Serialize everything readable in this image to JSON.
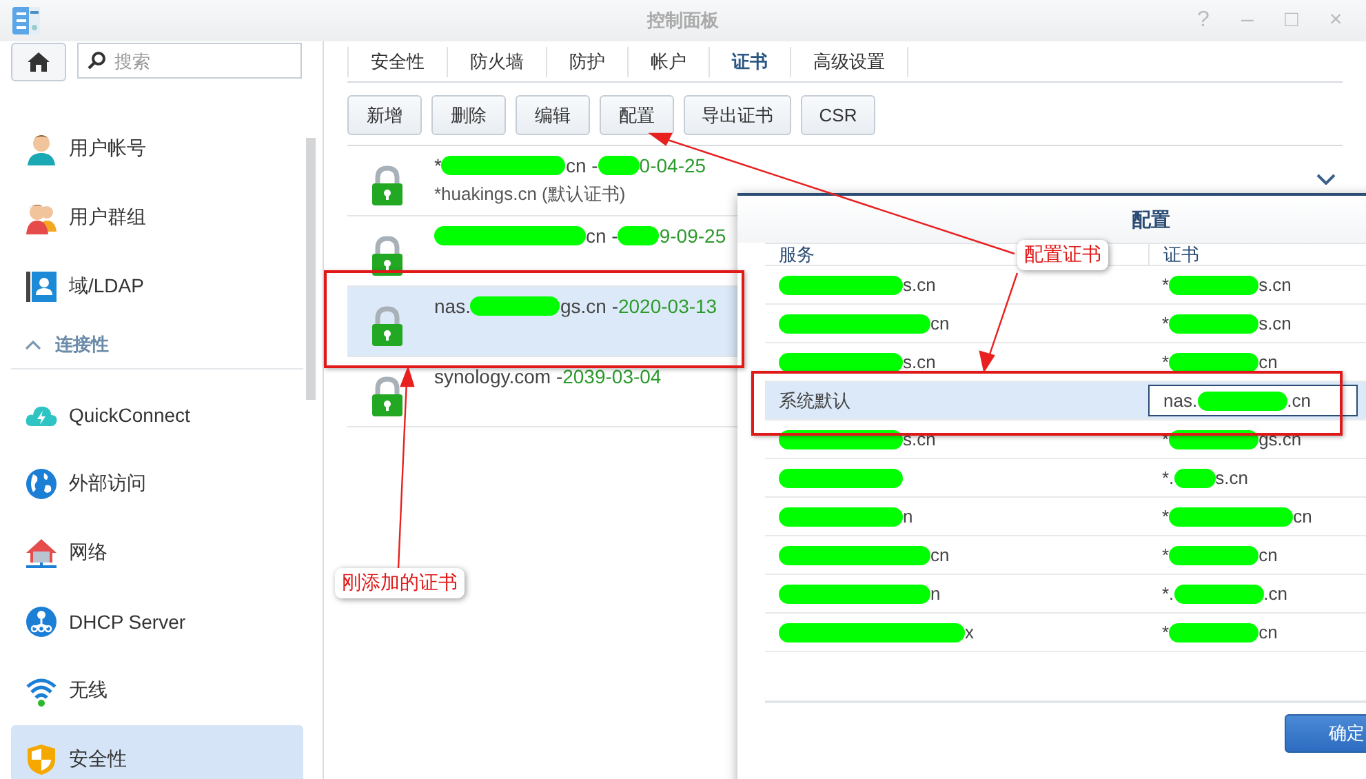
{
  "window": {
    "title": "控制面板",
    "controls": [
      "?",
      "–",
      "□",
      "×"
    ]
  },
  "search": {
    "placeholder": "搜索"
  },
  "sidebar": {
    "items": [
      {
        "kind": "item",
        "label": "用户帐号",
        "selected": false
      },
      {
        "kind": "item",
        "label": "用户群组",
        "selected": false
      },
      {
        "kind": "item",
        "label": "域/LDAP",
        "selected": false
      },
      {
        "kind": "section",
        "label": "连接性",
        "expanded": true
      },
      {
        "kind": "item",
        "label": "QuickConnect",
        "selected": false
      },
      {
        "kind": "item",
        "label": "外部访问",
        "selected": false
      },
      {
        "kind": "item",
        "label": "网络",
        "selected": false
      },
      {
        "kind": "item",
        "label": "DHCP Server",
        "selected": false
      },
      {
        "kind": "item",
        "label": "无线",
        "selected": false
      },
      {
        "kind": "item",
        "label": "安全性",
        "selected": true
      }
    ]
  },
  "tabs": [
    {
      "label": "安全性",
      "selected": false
    },
    {
      "label": "防火墙",
      "selected": false
    },
    {
      "label": "防护",
      "selected": false
    },
    {
      "label": "帐户",
      "selected": false
    },
    {
      "label": "证书",
      "selected": true
    },
    {
      "label": "高级设置",
      "selected": false
    }
  ],
  "toolbar": [
    "新增",
    "删除",
    "编辑",
    "配置",
    "导出证书",
    "CSR"
  ],
  "certificates": [
    {
      "selected": false,
      "title": [
        {
          "kind": "text",
          "t": "*"
        },
        {
          "kind": "long_mask"
        },
        {
          "kind": "text",
          "t": "cn - "
        },
        {
          "kind": "short_mask"
        },
        {
          "kind": "date",
          "t": "0-04-25"
        }
      ],
      "subtitle": "*huakings.cn (默认证书)"
    },
    {
      "selected": false,
      "title": [
        {
          "kind": "xlong_mask"
        },
        {
          "kind": "text",
          "t": "cn - "
        },
        {
          "kind": "short_mask"
        },
        {
          "kind": "date",
          "t": "9-09-25"
        }
      ]
    },
    {
      "selected": true,
      "title": [
        {
          "kind": "text",
          "t": "nas."
        },
        {
          "kind": "medium_mask"
        },
        {
          "kind": "text",
          "t": "gs.cn - "
        },
        {
          "kind": "date",
          "t": "2020-03-13"
        }
      ]
    },
    {
      "selected": false,
      "title": [
        {
          "kind": "text",
          "t": "synology.com - "
        },
        {
          "kind": "date",
          "t": "2039-03-04"
        }
      ]
    }
  ],
  "dialog": {
    "title": "配置",
    "columns": [
      "服务",
      "证书"
    ],
    "button": "确定",
    "rows": [
      {
        "selected": false,
        "service": [
          {
            "kind": "long_mask"
          },
          {
            "kind": "text",
            "t": "s.cn"
          }
        ],
        "certificate": [
          {
            "kind": "text",
            "t": "*"
          },
          {
            "kind": "medium_mask"
          },
          {
            "kind": "text",
            "t": "s.cn"
          }
        ]
      },
      {
        "selected": false,
        "service": [
          {
            "kind": "xlong_mask"
          },
          {
            "kind": "text",
            "t": "cn"
          }
        ],
        "certificate": [
          {
            "kind": "text",
            "t": "*"
          },
          {
            "kind": "medium_mask"
          },
          {
            "kind": "text",
            "t": "s.cn"
          }
        ]
      },
      {
        "selected": false,
        "service": [
          {
            "kind": "long_mask"
          },
          {
            "kind": "text",
            "t": "s.cn"
          }
        ],
        "certificate": [
          {
            "kind": "text",
            "t": "*"
          },
          {
            "kind": "medium_mask"
          },
          {
            "kind": "text",
            "t": "cn"
          }
        ]
      },
      {
        "selected": true,
        "service": [
          {
            "kind": "text",
            "t": "系统默认"
          }
        ],
        "certificate": [
          {
            "kind": "text",
            "t": "nas."
          },
          {
            "kind": "medium_mask"
          },
          {
            "kind": "text",
            "t": ".cn"
          }
        ]
      },
      {
        "selected": false,
        "service": [
          {
            "kind": "long_mask"
          },
          {
            "kind": "text",
            "t": "s.cn"
          }
        ],
        "certificate": [
          {
            "kind": "text",
            "t": "*"
          },
          {
            "kind": "medium_mask"
          },
          {
            "kind": "text",
            "t": "gs.cn"
          }
        ]
      },
      {
        "selected": false,
        "service": [
          {
            "kind": "long_mask"
          }
        ],
        "certificate": [
          {
            "kind": "text",
            "t": "*."
          },
          {
            "kind": "short_mask"
          },
          {
            "kind": "text",
            "t": "s.cn"
          }
        ]
      },
      {
        "selected": false,
        "service": [
          {
            "kind": "long_mask"
          },
          {
            "kind": "text",
            "t": "n"
          }
        ],
        "certificate": [
          {
            "kind": "text",
            "t": "*"
          },
          {
            "kind": "long_mask"
          },
          {
            "kind": "text",
            "t": "cn"
          }
        ]
      },
      {
        "selected": false,
        "service": [
          {
            "kind": "xlong_mask"
          },
          {
            "kind": "text",
            "t": "cn"
          }
        ],
        "certificate": [
          {
            "kind": "text",
            "t": "*"
          },
          {
            "kind": "medium_mask"
          },
          {
            "kind": "text",
            "t": "cn"
          }
        ]
      },
      {
        "selected": false,
        "service": [
          {
            "kind": "xlong_mask"
          },
          {
            "kind": "text",
            "t": "n"
          }
        ],
        "certificate": [
          {
            "kind": "text",
            "t": "*."
          },
          {
            "kind": "medium_mask"
          },
          {
            "kind": "text",
            "t": ".cn"
          }
        ]
      },
      {
        "selected": false,
        "service": [
          {
            "kind": "xxlong_mask"
          },
          {
            "kind": "text",
            "t": "x"
          }
        ],
        "certificate": [
          {
            "kind": "text",
            "t": "*"
          },
          {
            "kind": "medium_mask"
          },
          {
            "kind": "text",
            "t": "cn"
          }
        ]
      }
    ]
  },
  "annotations": {
    "callouts": [
      "配置证书",
      "刚添加的证书"
    ]
  }
}
